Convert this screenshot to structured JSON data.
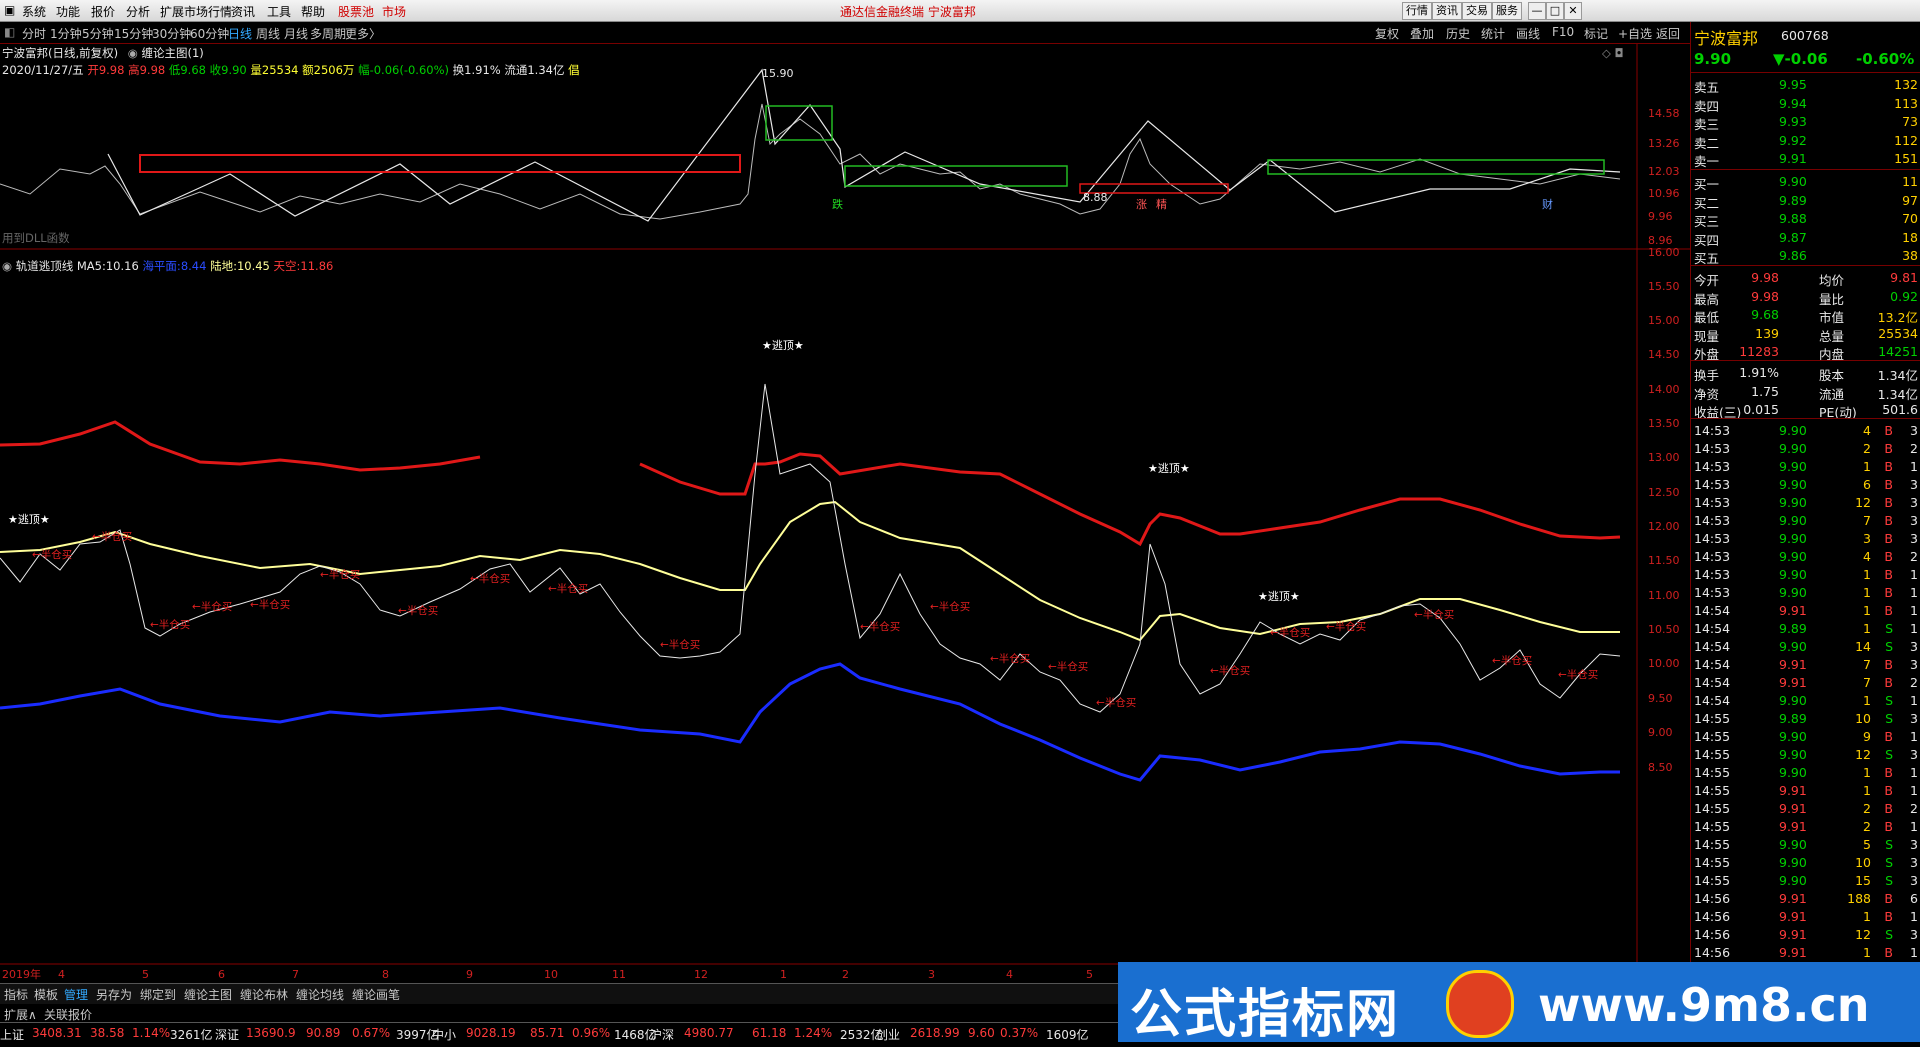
{
  "menu": {
    "items": [
      "系统",
      "功能",
      "报价",
      "分析",
      "扩展市场行情",
      "资讯",
      "工具",
      "帮助"
    ],
    "stock_pool": "股票池",
    "market": "市场",
    "title_center": "通达信金融终端  宁波富邦",
    "right_buttons": [
      "行情",
      "资讯",
      "交易",
      "服务"
    ]
  },
  "periods": {
    "items": [
      "分时",
      "1分钟",
      "5分钟",
      "15分钟",
      "30分钟",
      "60分钟",
      "日线",
      "周线",
      "月线",
      "多周期",
      "更多〉"
    ],
    "active": "日线"
  },
  "toolbar": {
    "items": [
      "复权",
      "叠加",
      "历史",
      "统计",
      "画线",
      "F10",
      "标记",
      "+自选",
      "返回"
    ]
  },
  "main_chart": {
    "title": "宁波富邦(日线,前复权)",
    "indicator_name": "缠论主图(1)",
    "date": "2020/11/27/五",
    "open_label": "开",
    "open": "9.98",
    "high_label": "高",
    "high": "9.98",
    "low_label": "低",
    "low": "9.68",
    "close_label": "收",
    "close": "9.90",
    "vol_label": "量",
    "vol": "25534",
    "amount_label": "额",
    "amount": "2506万",
    "chg_label": "幅",
    "chg": "-0.06(-0.60%)",
    "turnover_label": "换",
    "turnover": "1.91%",
    "float_label": "流通",
    "float": "1.34亿",
    "tail": "倡",
    "dll_note": "用到DLL函数",
    "peak_label": "15.90",
    "low_point_label": "8.88",
    "y_ticks": [
      "14.58",
      "13.26",
      "12.03",
      "10.96",
      "9.96",
      "8.96"
    ],
    "markers": [
      "跌",
      "涨",
      "精",
      "财"
    ]
  },
  "sub_chart": {
    "name": "轨道逃顶线",
    "ma5_label": "MA5:",
    "ma5": "10.16",
    "sea_label": "海平面:",
    "sea": "8.44",
    "land_label": "陆地:",
    "land": "10.45",
    "sky_label": "天空:",
    "sky": "11.86",
    "escape_label": "★逃顶★",
    "buy_label": "←半仓买",
    "y_ticks": [
      "16.00",
      "15.50",
      "15.00",
      "14.50",
      "14.00",
      "13.50",
      "13.00",
      "12.50",
      "12.00",
      "11.50",
      "11.00",
      "10.50",
      "10.00",
      "9.50",
      "9.00",
      "8.50"
    ]
  },
  "x_axis": [
    "2019年",
    "4",
    "5",
    "6",
    "7",
    "8",
    "9",
    "10",
    "11",
    "12",
    "1",
    "2",
    "3",
    "4",
    "5"
  ],
  "quote": {
    "name": "宁波富邦",
    "code": "600768",
    "price": "9.90",
    "change": "▼-0.06",
    "pct": "-0.60%",
    "asks": [
      {
        "label": "卖五",
        "price": "9.95",
        "vol": "132"
      },
      {
        "label": "卖四",
        "price": "9.94",
        "vol": "113"
      },
      {
        "label": "卖三",
        "price": "9.93",
        "vol": "73"
      },
      {
        "label": "卖二",
        "price": "9.92",
        "vol": "112"
      },
      {
        "label": "卖一",
        "price": "9.91",
        "vol": "151"
      }
    ],
    "bids": [
      {
        "label": "买一",
        "price": "9.90",
        "vol": "11"
      },
      {
        "label": "买二",
        "price": "9.89",
        "vol": "97"
      },
      {
        "label": "买三",
        "price": "9.88",
        "vol": "70"
      },
      {
        "label": "买四",
        "price": "9.87",
        "vol": "18"
      },
      {
        "label": "买五",
        "price": "9.86",
        "vol": "38"
      }
    ],
    "stats": [
      {
        "l1": "今开",
        "v1": "9.98",
        "l2": "均价",
        "v2": "9.81"
      },
      {
        "l1": "最高",
        "v1": "9.98",
        "l2": "量比",
        "v2": "0.92"
      },
      {
        "l1": "最低",
        "v1": "9.68",
        "l2": "市值",
        "v2": "13.2亿"
      },
      {
        "l1": "现量",
        "v1": "139",
        "l2": "总量",
        "v2": "25534"
      },
      {
        "l1": "外盘",
        "v1": "11283",
        "l2": "内盘",
        "v2": "14251"
      }
    ],
    "stats2": [
      {
        "l1": "换手",
        "v1": "1.91%",
        "l2": "股本",
        "v2": "1.34亿"
      },
      {
        "l1": "净资",
        "v1": "1.75",
        "l2": "流通",
        "v2": "1.34亿"
      },
      {
        "l1": "收益(三)",
        "v1": "0.015",
        "l2": "PE(动)",
        "v2": "501.6"
      }
    ],
    "ticks": [
      {
        "t": "14:53",
        "p": "9.90",
        "v": "4",
        "d": "B",
        "n": "3"
      },
      {
        "t": "14:53",
        "p": "9.90",
        "v": "2",
        "d": "B",
        "n": "2"
      },
      {
        "t": "14:53",
        "p": "9.90",
        "v": "1",
        "d": "B",
        "n": "1"
      },
      {
        "t": "14:53",
        "p": "9.90",
        "v": "6",
        "d": "B",
        "n": "3"
      },
      {
        "t": "14:53",
        "p": "9.90",
        "v": "12",
        "d": "B",
        "n": "3"
      },
      {
        "t": "14:53",
        "p": "9.90",
        "v": "7",
        "d": "B",
        "n": "3"
      },
      {
        "t": "14:53",
        "p": "9.90",
        "v": "3",
        "d": "B",
        "n": "3"
      },
      {
        "t": "14:53",
        "p": "9.90",
        "v": "4",
        "d": "B",
        "n": "2"
      },
      {
        "t": "14:53",
        "p": "9.90",
        "v": "1",
        "d": "B",
        "n": "1"
      },
      {
        "t": "14:53",
        "p": "9.90",
        "v": "1",
        "d": "B",
        "n": "1"
      },
      {
        "t": "14:54",
        "p": "9.91",
        "v": "1",
        "d": "B",
        "n": "1"
      },
      {
        "t": "14:54",
        "p": "9.89",
        "v": "1",
        "d": "S",
        "n": "1"
      },
      {
        "t": "14:54",
        "p": "9.90",
        "v": "14",
        "d": "S",
        "n": "3"
      },
      {
        "t": "14:54",
        "p": "9.91",
        "v": "7",
        "d": "B",
        "n": "3"
      },
      {
        "t": "14:54",
        "p": "9.91",
        "v": "7",
        "d": "B",
        "n": "2"
      },
      {
        "t": "14:54",
        "p": "9.90",
        "v": "1",
        "d": "S",
        "n": "1"
      },
      {
        "t": "14:55",
        "p": "9.89",
        "v": "10",
        "d": "S",
        "n": "3"
      },
      {
        "t": "14:55",
        "p": "9.90",
        "v": "9",
        "d": "B",
        "n": "1"
      },
      {
        "t": "14:55",
        "p": "9.90",
        "v": "12",
        "d": "S",
        "n": "3"
      },
      {
        "t": "14:55",
        "p": "9.90",
        "v": "1",
        "d": "B",
        "n": "1"
      },
      {
        "t": "14:55",
        "p": "9.91",
        "v": "1",
        "d": "B",
        "n": "1"
      },
      {
        "t": "14:55",
        "p": "9.91",
        "v": "2",
        "d": "B",
        "n": "2"
      },
      {
        "t": "14:55",
        "p": "9.91",
        "v": "2",
        "d": "B",
        "n": "1"
      },
      {
        "t": "14:55",
        "p": "9.90",
        "v": "5",
        "d": "S",
        "n": "3"
      },
      {
        "t": "14:55",
        "p": "9.90",
        "v": "10",
        "d": "S",
        "n": "3"
      },
      {
        "t": "14:55",
        "p": "9.90",
        "v": "15",
        "d": "S",
        "n": "3"
      },
      {
        "t": "14:56",
        "p": "9.91",
        "v": "188",
        "d": "B",
        "n": "6"
      },
      {
        "t": "14:56",
        "p": "9.91",
        "v": "1",
        "d": "B",
        "n": "1"
      },
      {
        "t": "14:56",
        "p": "9.91",
        "v": "12",
        "d": "S",
        "n": "3"
      },
      {
        "t": "14:56",
        "p": "9.91",
        "v": "1",
        "d": "B",
        "n": "1"
      }
    ]
  },
  "bottom_tabs": [
    "指标",
    "模板",
    "管理",
    "另存为",
    "绑定到",
    "缠论主图",
    "缠论布林",
    "缠论均线",
    "缠论画笔"
  ],
  "ext_label": "扩展∧",
  "ext_link": "关联报价",
  "status": [
    {
      "name": "上证",
      "val": "3408.31",
      "chg": "38.58",
      "pct": "1.14%",
      "amt": "3261亿"
    },
    {
      "name": "深证",
      "val": "13690.9",
      "chg": "90.89",
      "pct": "0.67%",
      "amt": "3997亿"
    },
    {
      "name": "中小",
      "val": "9028.19",
      "chg": "85.71",
      "pct": "0.96%",
      "amt": "1468亿"
    },
    {
      "name": "沪深",
      "val": "4980.77",
      "chg": "61.18",
      "pct": "1.24%",
      "amt": "2532亿"
    },
    {
      "name": "创业",
      "val": "2618.99",
      "chg": "9.60",
      "pct": "0.37%",
      "amt": "1609亿"
    }
  ],
  "banner": {
    "text": "公式指标网",
    "url": "www.9m8.cn"
  }
}
